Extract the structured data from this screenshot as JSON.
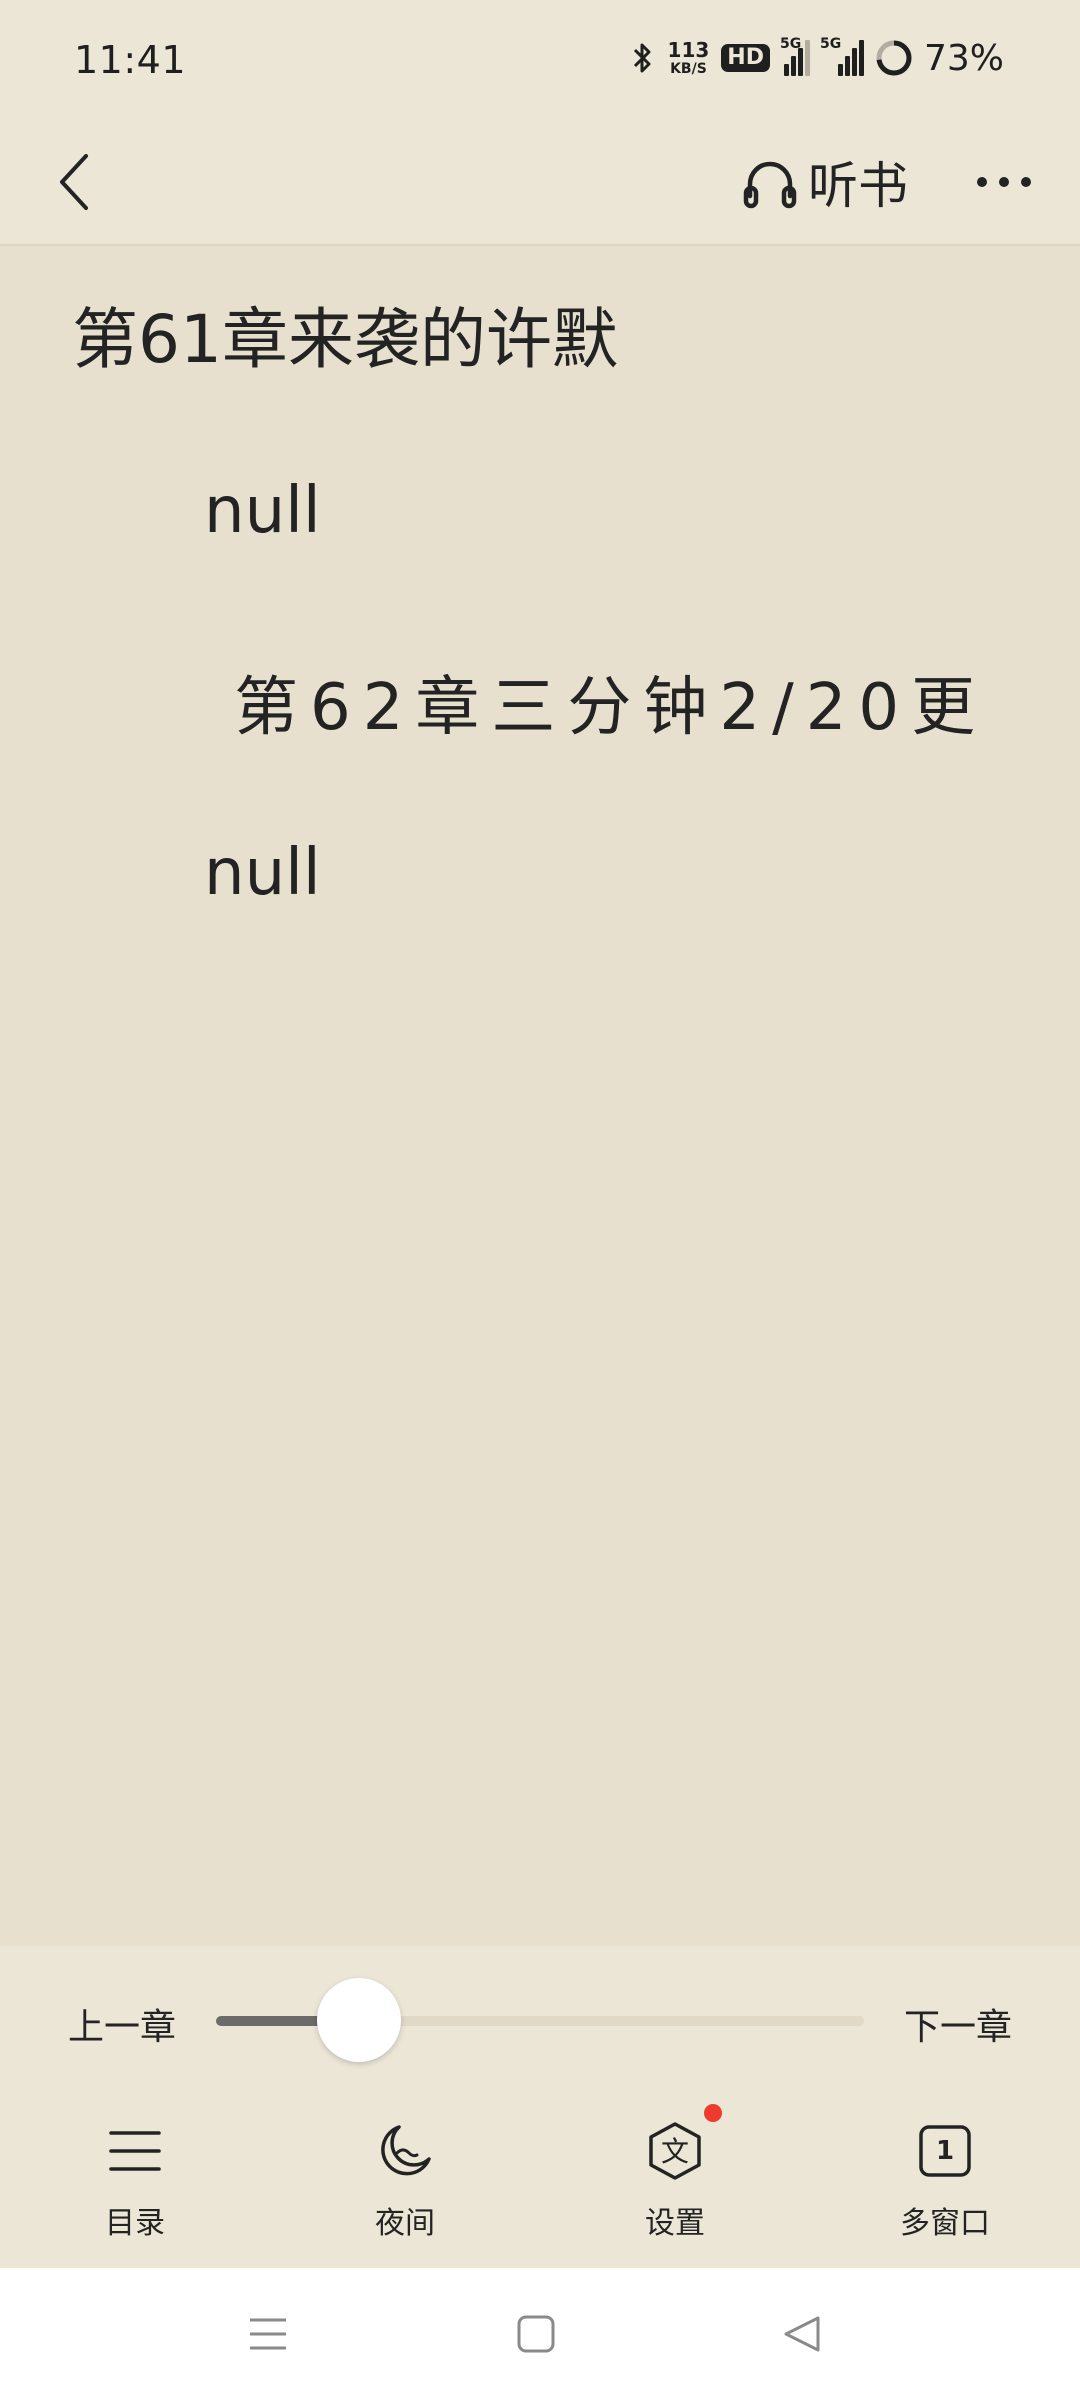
{
  "status_bar": {
    "time": "11:41",
    "net_speed": {
      "value": "113",
      "unit": "KB/S"
    },
    "hd_badge": "HD",
    "sim1": {
      "tag": "5G"
    },
    "sim2": {
      "tag": "5G"
    },
    "battery": "73%",
    "battery_level": 0.73,
    "icons": [
      "bluetooth-icon",
      "hd-icon",
      "signal-icon",
      "battery-icon"
    ]
  },
  "header": {
    "back_icon": "chevron-left-icon",
    "listen_label": "听书",
    "listen_icon": "headphones-icon",
    "more_icon": "more-icon"
  },
  "content": {
    "chapter_title": "第61章来袭的许默",
    "paragraphs": [
      "null",
      "第62章三分钟2/20更",
      "null"
    ]
  },
  "controls": {
    "prev_chapter": "上一章",
    "next_chapter": "下一章",
    "progress": 0.22,
    "toolbar": [
      {
        "label": "目录",
        "icon": "menu-icon"
      },
      {
        "label": "夜间",
        "icon": "moon-icon"
      },
      {
        "label": "设置",
        "icon": "settings-icon",
        "badge": true
      },
      {
        "label": "多窗口",
        "icon": "window-icon",
        "count": "1"
      }
    ]
  },
  "nav_bar": {
    "icons": [
      "menu-nav-icon",
      "home-nav-icon",
      "back-nav-icon"
    ]
  },
  "colors": {
    "background": "#ece6d7",
    "content_background": "#e7e0ce",
    "text": "#232323",
    "accent_dot": "#ee3b2e",
    "progress_fill": "#6b6b6b"
  }
}
